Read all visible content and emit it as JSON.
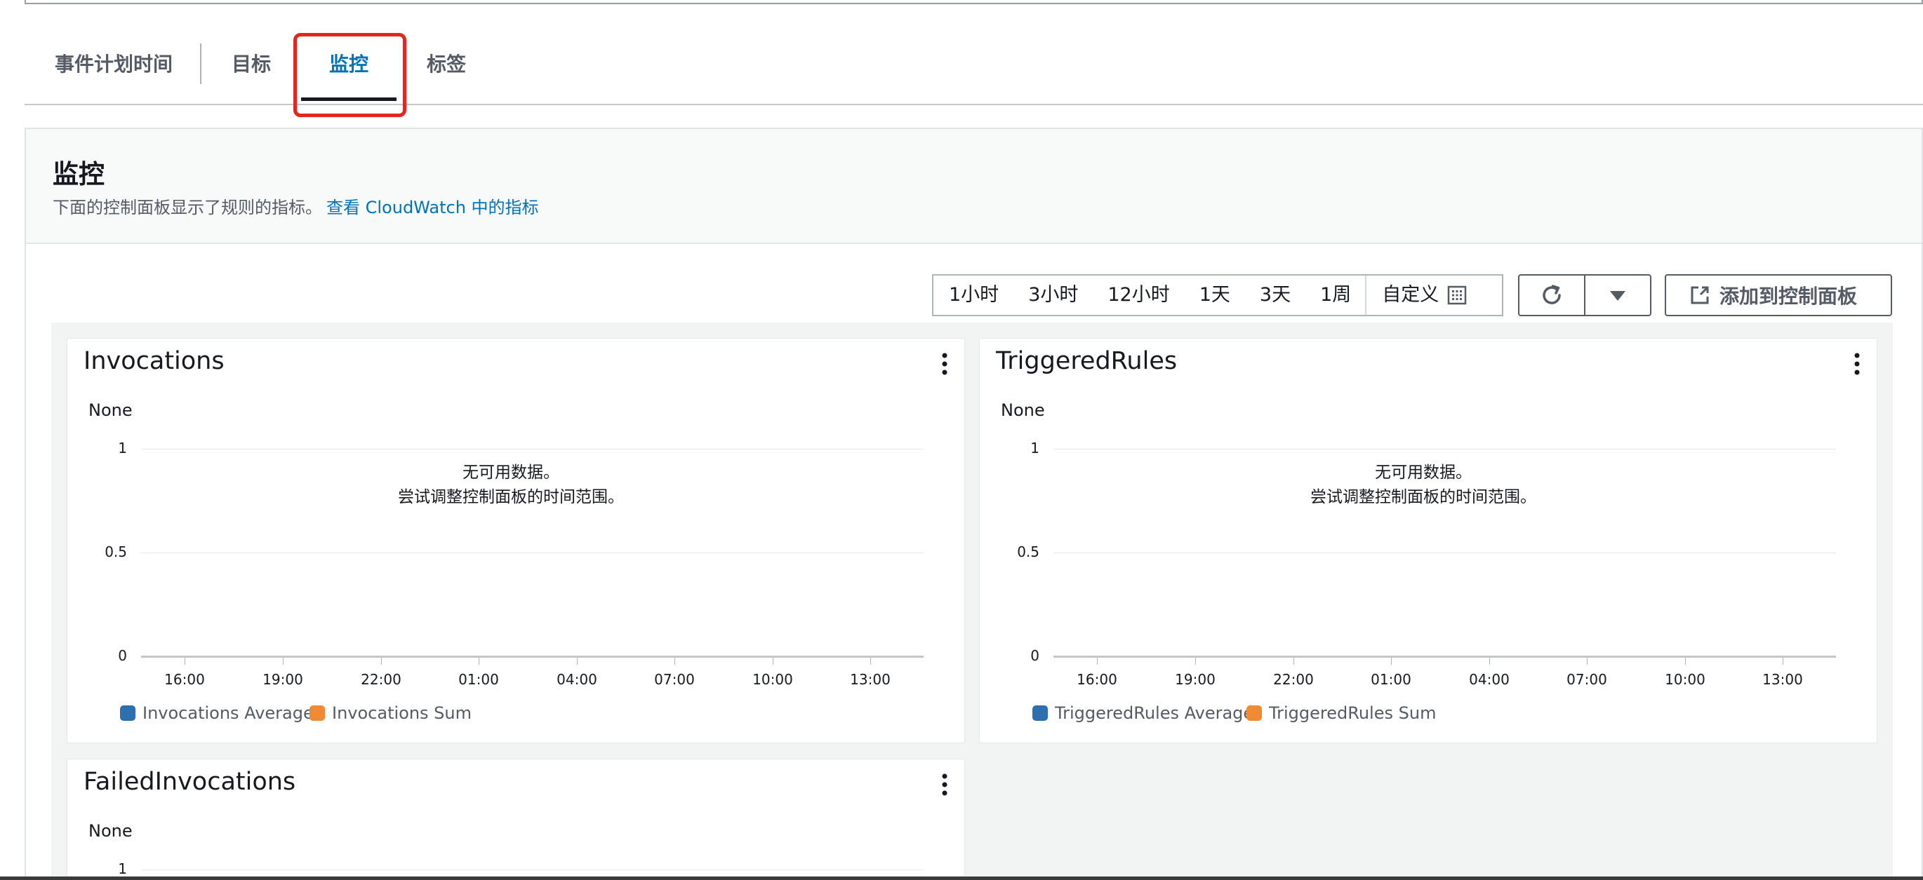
{
  "tabs": [
    {
      "label": "事件计划时间"
    },
    {
      "label": "目标"
    },
    {
      "label": "监控",
      "active": true
    },
    {
      "label": "标签"
    }
  ],
  "panel": {
    "title": "监控",
    "description": "下面的控制面板显示了规则的指标。",
    "link_text": "查看 CloudWatch 中的指标"
  },
  "time_range": {
    "options": [
      "1小时",
      "3小时",
      "12小时",
      "1天",
      "3天",
      "1周"
    ],
    "custom_label": "自定义",
    "custom_icon": "calendar-icon"
  },
  "toolbar": {
    "refresh_icon": "refresh-icon",
    "dropdown_icon": "caret-down-icon",
    "add_icon": "external-link-icon",
    "add_label": "添加到控制面板"
  },
  "colors": {
    "accent_link": "#0073bb",
    "highlight_box": "#e0281d",
    "series_average": "#2e6fb0",
    "series_sum": "#f08a34"
  },
  "widgets": [
    {
      "title": "Invocations",
      "unit": "None",
      "no_data_line1": "无可用数据。",
      "no_data_line2": "尝试调整控制面板的时间范围。",
      "legend": [
        "Invocations Average",
        "Invocations Sum"
      ]
    },
    {
      "title": "TriggeredRules",
      "unit": "None",
      "no_data_line1": "无可用数据。",
      "no_data_line2": "尝试调整控制面板的时间范围。",
      "legend": [
        "TriggeredRules Average",
        "TriggeredRules Sum"
      ]
    },
    {
      "title": "FailedInvocations",
      "unit": "None"
    }
  ],
  "chart_data": [
    {
      "type": "line",
      "title": "Invocations",
      "ylabel": "None",
      "ylim": [
        0,
        1
      ],
      "yticks": [
        "1",
        "0.5",
        "0"
      ],
      "x": [
        "16:00",
        "19:00",
        "22:00",
        "01:00",
        "04:00",
        "07:00",
        "10:00",
        "13:00"
      ],
      "series": [
        {
          "name": "Invocations Average",
          "values": []
        },
        {
          "name": "Invocations Sum",
          "values": []
        }
      ],
      "grid": true,
      "legend": "bottom-left"
    },
    {
      "type": "line",
      "title": "TriggeredRules",
      "ylabel": "None",
      "ylim": [
        0,
        1
      ],
      "yticks": [
        "1",
        "0.5",
        "0"
      ],
      "x": [
        "16:00",
        "19:00",
        "22:00",
        "01:00",
        "04:00",
        "07:00",
        "10:00",
        "13:00"
      ],
      "series": [
        {
          "name": "TriggeredRules Average",
          "values": []
        },
        {
          "name": "TriggeredRules Sum",
          "values": []
        }
      ],
      "grid": true,
      "legend": "bottom-left"
    },
    {
      "type": "line",
      "title": "FailedInvocations",
      "ylabel": "None",
      "yticks": [
        "1"
      ],
      "grid": true
    }
  ]
}
